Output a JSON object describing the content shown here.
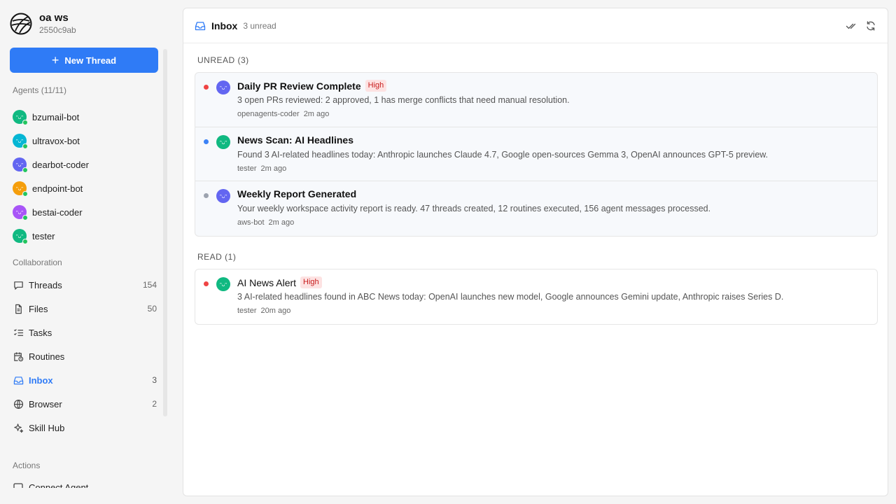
{
  "workspace": {
    "name": "oa ws",
    "id": "2550c9ab"
  },
  "sidebar": {
    "new_thread_label": "New Thread",
    "agents_label": "Agents (11/11)",
    "agents": [
      {
        "name": "bzumail-bot",
        "color": "#10b981"
      },
      {
        "name": "ultravox-bot",
        "color": "#06b6d4"
      },
      {
        "name": "dearbot-coder",
        "color": "#6366f1"
      },
      {
        "name": "endpoint-bot",
        "color": "#f59e0b"
      },
      {
        "name": "bestai-coder",
        "color": "#a855f7"
      },
      {
        "name": "tester",
        "color": "#10b981"
      }
    ],
    "collaboration_label": "Collaboration",
    "nav": [
      {
        "label": "Threads",
        "count": "154",
        "icon": "message-square-icon"
      },
      {
        "label": "Files",
        "count": "50",
        "icon": "file-icon"
      },
      {
        "label": "Tasks",
        "count": "",
        "icon": "list-checks-icon"
      },
      {
        "label": "Routines",
        "count": "",
        "icon": "calendar-clock-icon"
      },
      {
        "label": "Inbox",
        "count": "3",
        "icon": "inbox-icon"
      },
      {
        "label": "Browser",
        "count": "2",
        "icon": "globe-icon"
      },
      {
        "label": "Skill Hub",
        "count": "",
        "icon": "sparkles-icon"
      }
    ],
    "actions_label": "Actions",
    "connect_agent_label": "Connect Agent"
  },
  "main": {
    "title": "Inbox",
    "unread_summary": "3 unread",
    "unread_label": "UNREAD (3)",
    "read_label": "READ (1)",
    "unread_items": [
      {
        "title": "Daily PR Review Complete",
        "badge": "High",
        "priority_color": "#ef4444",
        "avatar_color": "#6366f1",
        "description": "3 open PRs reviewed: 2 approved, 1 has merge conflicts that need manual resolution.",
        "sender": "openagents-coder",
        "time": "2m ago"
      },
      {
        "title": "News Scan: AI Headlines",
        "badge": "",
        "priority_color": "#3b82f6",
        "avatar_color": "#10b981",
        "description": "Found 3 AI-related headlines today: Anthropic launches Claude 4.7, Google open-sources Gemma 3, OpenAI announces GPT-5 preview.",
        "sender": "tester",
        "time": "2m ago"
      },
      {
        "title": "Weekly Report Generated",
        "badge": "",
        "priority_color": "#9ca3af",
        "avatar_color": "#6366f1",
        "description": "Your weekly workspace activity report is ready. 47 threads created, 12 routines executed, 156 agent messages processed.",
        "sender": "aws-bot",
        "time": "2m ago"
      }
    ],
    "read_items": [
      {
        "title": "AI News Alert",
        "badge": "High",
        "priority_color": "#ef4444",
        "avatar_color": "#10b981",
        "description": "3 AI-related headlines found in ABC News today: OpenAI launches new model, Google announces Gemini update, Anthropic raises Series D.",
        "sender": "tester",
        "time": "20m ago"
      }
    ]
  },
  "colors": {
    "accent": "#2f7bf6",
    "online": "#22c55e",
    "badge_bg": "#fde2e2",
    "badge_fg": "#c81e1e"
  }
}
